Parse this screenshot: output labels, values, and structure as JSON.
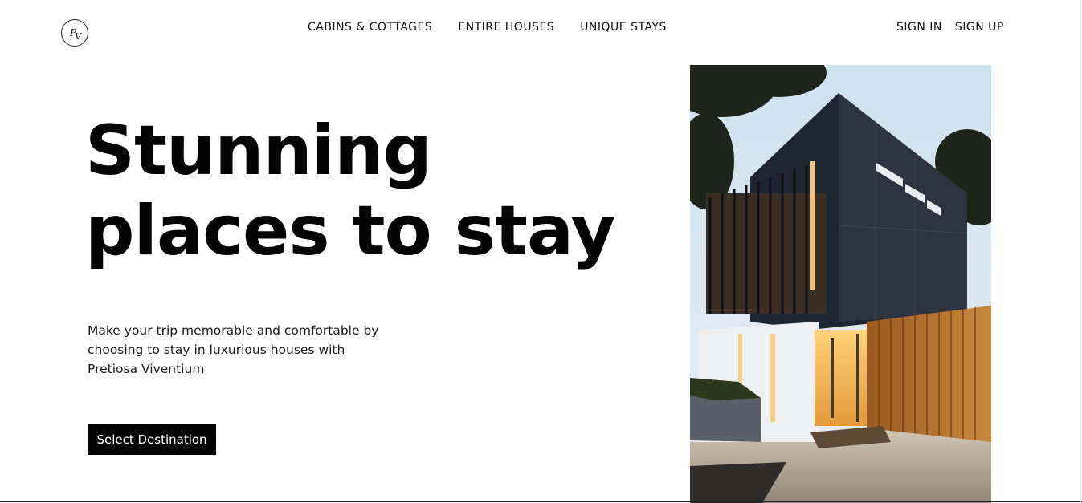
{
  "logo": {
    "text_p": "P",
    "text_v": "V"
  },
  "nav": {
    "items": [
      {
        "label": "CABINS & COTTAGES"
      },
      {
        "label": "ENTIRE HOUSES"
      },
      {
        "label": "UNIQUE STAYS"
      }
    ]
  },
  "auth": {
    "sign_in": "SIGN IN",
    "sign_up": "SIGN UP"
  },
  "hero": {
    "headline_line1": "Stunning",
    "headline_line2": "places to stay",
    "description": "Make your trip memorable and comfortable by choosing to stay in luxurious houses with Pretiosa Viventium",
    "cta_label": "Select Destination"
  },
  "colors": {
    "text": "#050505",
    "background": "#ffffff",
    "cta_bg": "#050505",
    "cta_text": "#ffffff"
  },
  "image": {
    "subject": "modern-house-photo"
  }
}
